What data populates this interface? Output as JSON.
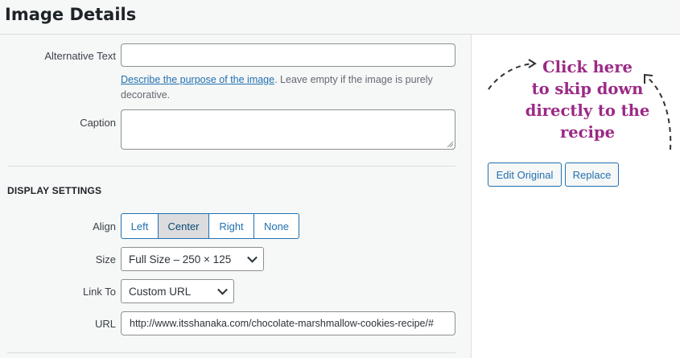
{
  "header": {
    "title": "Image Details"
  },
  "form": {
    "alt_text": {
      "label": "Alternative Text",
      "value": ""
    },
    "help": {
      "link_text": "Describe the purpose of the image",
      "rest": ". Leave empty if the image is purely decorative."
    },
    "caption": {
      "label": "Caption",
      "value": ""
    }
  },
  "display_settings": {
    "title": "DISPLAY SETTINGS",
    "align": {
      "label": "Align",
      "options": [
        "Left",
        "Center",
        "Right",
        "None"
      ],
      "selected": "Center"
    },
    "size": {
      "label": "Size",
      "value": "Full Size – 250 × 125"
    },
    "link_to": {
      "label": "Link To",
      "value": "Custom URL"
    },
    "url": {
      "label": "URL",
      "value": "http://www.itsshanaka.com/chocolate-marshmallow-cookies-recipe/#"
    }
  },
  "sidebar": {
    "annotation": [
      "Click here",
      "to skip down",
      "directly to the",
      "recipe"
    ],
    "edit_original": "Edit Original",
    "replace": "Replace"
  },
  "colors": {
    "accent": "#2271b1",
    "annotation": "#9b2a86"
  }
}
